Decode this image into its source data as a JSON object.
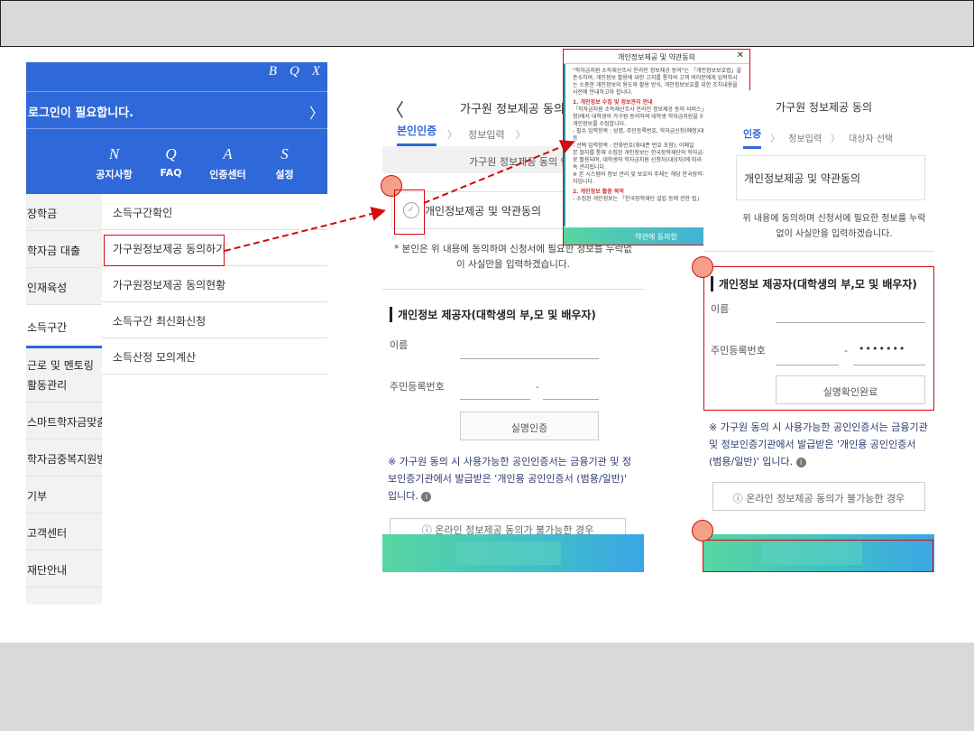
{
  "left_panel": {
    "top_icons": [
      "B",
      "Q",
      "X"
    ],
    "login_text": "로그인이 필요합니다.",
    "login_chevron": "〉",
    "quick_menu": [
      {
        "icon": "N",
        "label": "공지사항"
      },
      {
        "icon": "Q",
        "label": "FAQ"
      },
      {
        "icon": "A",
        "label": "인증센터"
      },
      {
        "icon": "S",
        "label": "설정"
      }
    ],
    "side_menu": [
      "장학금",
      "학자금 대출",
      "인재육성",
      "소득구간",
      "근로 및 멘토링 활동관리",
      "스마트학자금맞춤설계",
      "학자금중복지원방지",
      "기부",
      "고객센터",
      "재단안내"
    ],
    "sub_menu": [
      "소득구간확인",
      "가구원정보제공 동의하기",
      "가구원정보제공 동의현황",
      "소득구간 최신화신청",
      "소득산정 모의계산"
    ]
  },
  "middle_panel": {
    "back_icon": "〈",
    "title": "가구원 정보제공 동의",
    "steps": [
      "본인인증",
      "정보입력"
    ],
    "step_sep": "〉",
    "gray_bar": "가구원 정보제공 동의 안",
    "consent_check": "✓",
    "consent_label": "개인정보제공 및 약관동의",
    "note": "* 본인은 위 내용에 동의하며 신청서에 필요한 정보를 누락없이 사실만을 입력하겠습니다.",
    "provider_title": "개인정보 제공자(대학생의 부,모 및 배우자)",
    "name_label": "이름",
    "rrn_label": "주민등록번호",
    "dash": "-",
    "auth_button": "실명인증",
    "notice": "※ 가구원 동의 시 사용가능한 공인인증서는 금융기관 및 정보인증기관에서 발급받은 '개인용 공인인증서 (범용/일반)' 입니다.",
    "info_icon": "i",
    "online_button": "ⓘ 온라인 정보제공 동의가 불가능한 경우"
  },
  "popup": {
    "title": "개인정보제공 및 약관동의",
    "close": "✕",
    "intro": "\"학자금지원 소득재산조사 온라인 정보제공 동의\"는 「개인정보보호법」을 준수하여, 개인정보 활용에 대한 고지를 통하여 고객 여러분에게 입력하시는 소중한 개인정보의 용도와 활용 방식, 개인정보보호를 위한 조치내용을 사전에 안내하고자 합니다.",
    "sec1": "1. 개인정보 수집 및 정보관리 안내",
    "sec1_body": "「학자금지원 소득재산조사 온라인 정보제공 동의 서비스」는 학자금(신청)에서 대학생의 가구원 동의하여 대학생 학자금지원을 위해 아래와 같은 개인정보를 수집합니다.",
    "item1": "- 필수 입력항목 : 성명, 주민등록번호, 학자금신청(예정)대학생과의 관계 등",
    "item2": "- 선택 입력항목 : 전화번호(휴대폰 번호 포함), 이메일",
    "item3": "본 절차를 통해 수집된 개인정보는 한국장학재단의 학자금지원을 위한 자료로 활용되며, 대학생의 학자금지원 신청자(대상자)에 따라 처리되며 이후 지속 관리됩니다.",
    "item4": "※ 본 시스템의 정보 관리 및 보호의 주체는 해당 한국장학재단 및 관련 용사자입니다.",
    "sec2": "2. 개인정보 활용 목적",
    "sec2_body": "- 수집된 개인정보는 「한국장학재단 설립 등에 관한 법」",
    "agree_button": "약관에 동의함"
  },
  "right_panel": {
    "title": "가구원 정보제공 동의",
    "steps": [
      "인증",
      "정보입력",
      "대상자 선택"
    ],
    "step_sep": "〉",
    "consent_label": "개인정보제공 및 약관동의",
    "note": "위 내용에 동의하며 신청서에 필요한 정보를 누락없이 사실만을 입력하겠습니다.",
    "provider_title": "개인정보 제공자(대학생의 부,모 및 배우자)",
    "name_label": "이름",
    "rrn_label": "주민등록번호",
    "dash": "-",
    "rrn_masked": "•••••••",
    "confirm_button": "실명확인완료",
    "notice": "※ 가구원 동의 시 사용가능한 공인인증서는 금융기관 및 정보인증기관에서 발급받은 '개인용 공인인증서 (범용/일반)' 입니다.",
    "info_icon": "i",
    "online_button": "ⓘ 온라인 정보제공 동의가 불가능한 경우"
  },
  "colors": {
    "brand_blue": "#2f68d8",
    "highlight_red": "#d20a11",
    "marker_fill": "#f4a088"
  }
}
